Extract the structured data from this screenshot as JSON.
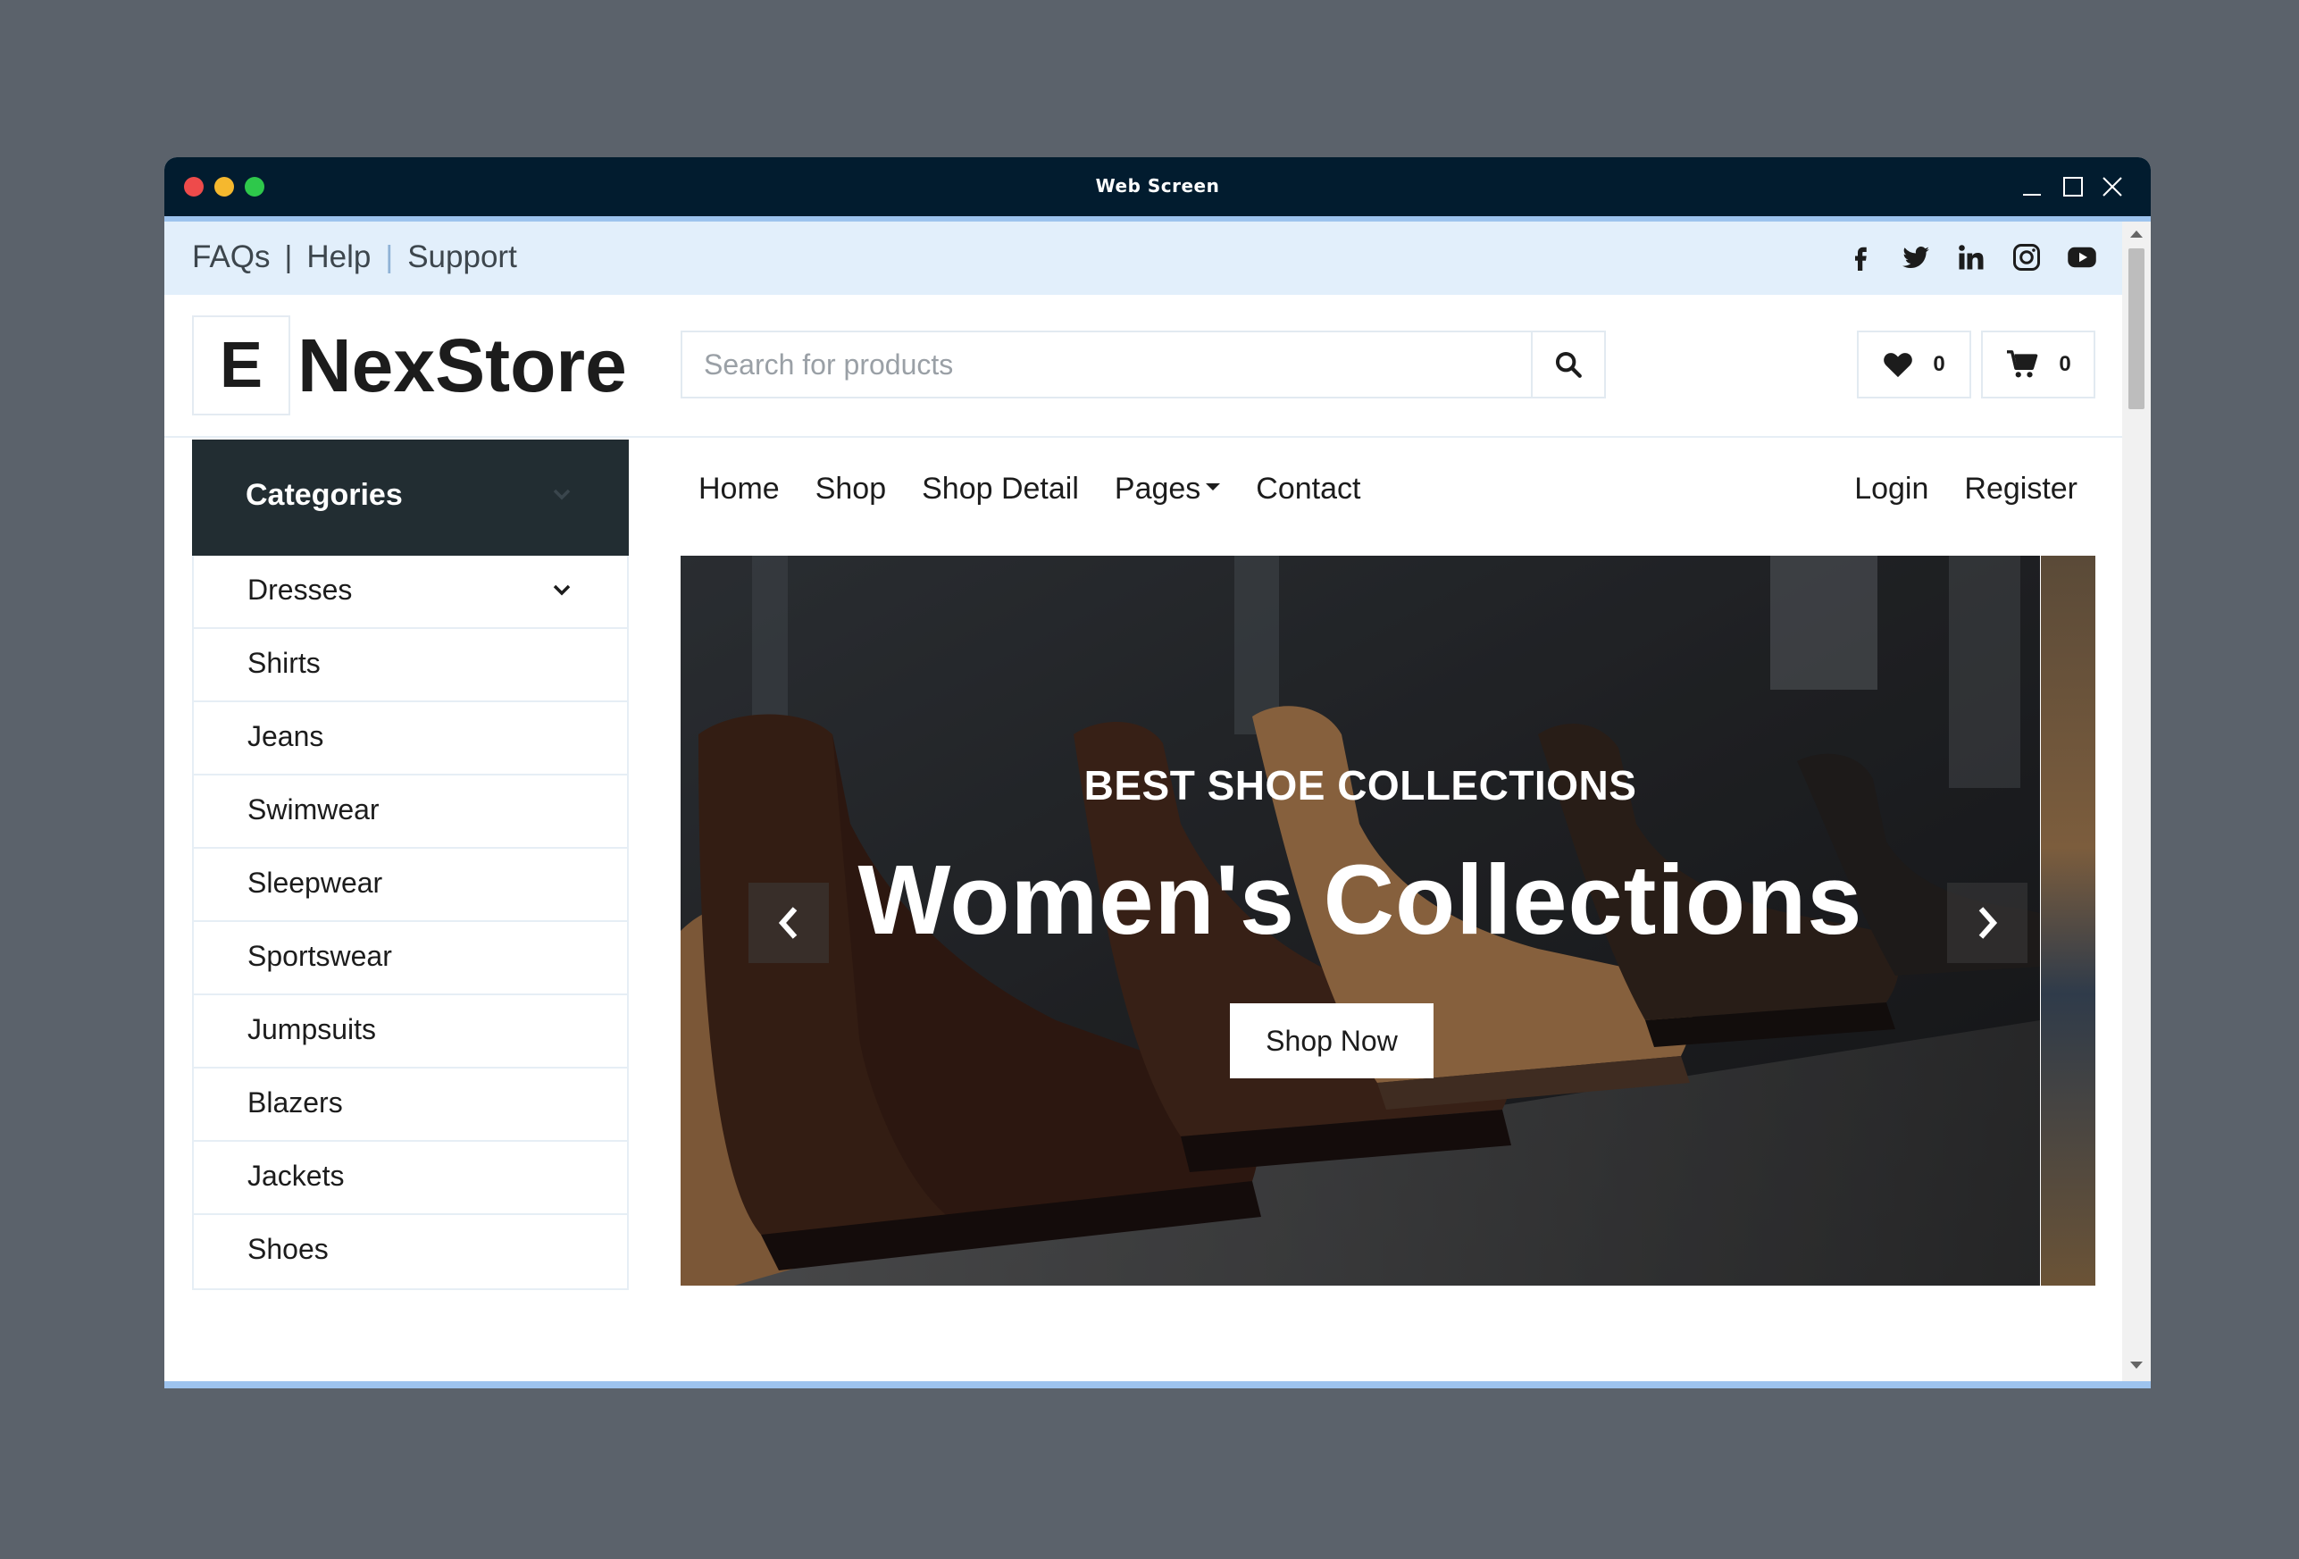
{
  "window": {
    "title": "Web Screen"
  },
  "topbar": {
    "links": [
      "FAQs",
      "Help",
      "Support"
    ],
    "social_icons": [
      "facebook-icon",
      "twitter-icon",
      "linkedin-icon",
      "instagram-icon",
      "youtube-icon"
    ]
  },
  "header": {
    "logo_letter": "E",
    "logo_text": "NexStore",
    "search_placeholder": "Search for products",
    "wishlist_count": "0",
    "cart_count": "0"
  },
  "categories": {
    "title": "Categories",
    "items": [
      "Dresses",
      "Shirts",
      "Jeans",
      "Swimwear",
      "Sleepwear",
      "Sportswear",
      "Jumpsuits",
      "Blazers",
      "Jackets",
      "Shoes"
    ]
  },
  "nav": {
    "items": [
      "Home",
      "Shop",
      "Shop Detail",
      "Pages",
      "Contact"
    ],
    "right": [
      "Login",
      "Register"
    ]
  },
  "hero": {
    "subtitle": "BEST SHOE COLLECTIONS",
    "title": "Women's Collections",
    "button": "Shop Now"
  },
  "colors": {
    "titlebar": "#021c2f",
    "topbar": "#e2effb",
    "categories_header": "#222d32",
    "text": "#1c1c1c"
  }
}
